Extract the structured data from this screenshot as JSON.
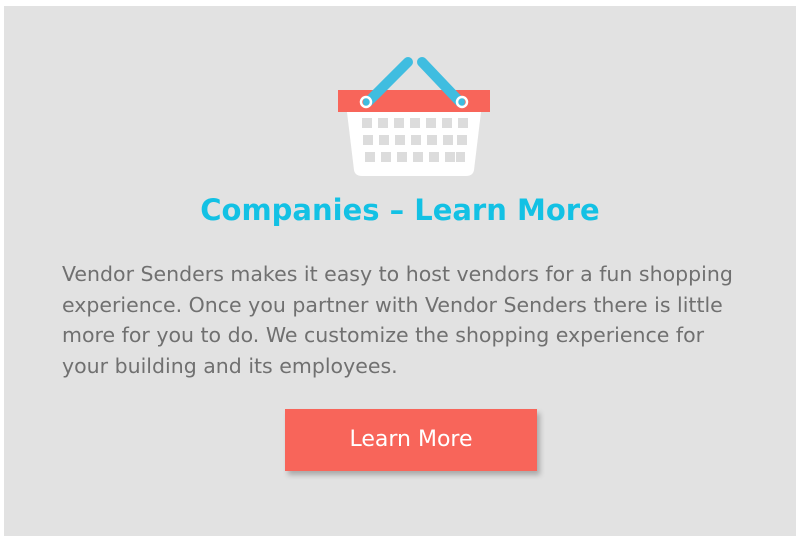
{
  "icon": "shopping-basket-icon",
  "colors": {
    "background": "#e2e2e2",
    "title": "#13c1e4",
    "body_text": "#707070",
    "button": "#f8655a",
    "button_text": "#ffffff",
    "basket_rim": "#f8655a",
    "basket_handle": "#3fbde0",
    "basket_body": "#ffffff",
    "basket_holes": "#dcdcdc"
  },
  "section": {
    "title": "Companies – Learn More",
    "body": "Vendor Senders makes it easy to host vendors for a fun shopping experience. Once you partner with Vendor Senders there is little more for you to do. We customize the shopping experience for your building and its employees.",
    "button_label": "Learn More"
  }
}
